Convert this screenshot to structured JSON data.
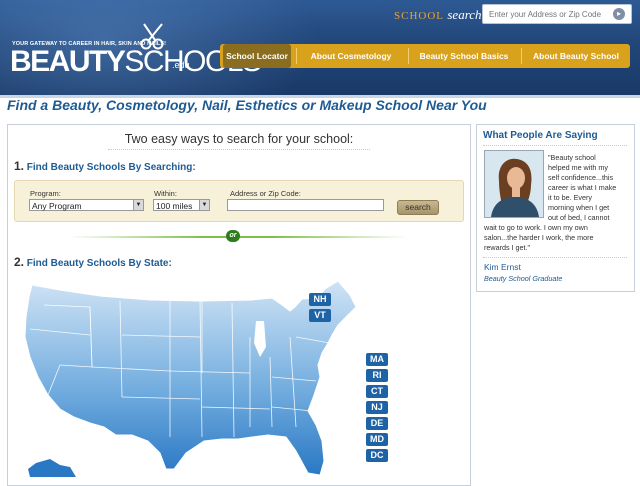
{
  "header": {
    "tagline": "YOUR GATEWAY TO CAREER IN HAIR, SKIN AND NAILS!",
    "logo_bold": "BEAUTY",
    "logo_light": "SCHOOLS",
    "logo_suffix": ".edu",
    "school_search_label_1": "SCHOOL",
    "school_search_label_2": "search",
    "search_placeholder": "Enter your Address or Zip Code",
    "nav": [
      {
        "label": "School Locator"
      },
      {
        "label": "About Cosmetology"
      },
      {
        "label": "Beauty School Basics"
      },
      {
        "label": "About Beauty School"
      }
    ]
  },
  "page": {
    "headline": "Find a Beauty, Cosmetology, Nail, Esthetics or Makeup School Near You"
  },
  "main": {
    "title": "Two easy ways to search for your school:",
    "step1_num": "1.",
    "step1_title": "Find Beauty Schools By Searching:",
    "program_label": "Program:",
    "program_value": "Any Program",
    "within_label": "Within:",
    "within_value": "100 miles",
    "zip_label": "Address or Zip Code:",
    "search_button": "search",
    "or_label": "or",
    "step2_num": "2.",
    "step2_title": "Find Beauty Schools By State:",
    "state_tags": [
      "NH",
      "VT",
      "MA",
      "RI",
      "CT",
      "NJ",
      "DE",
      "MD",
      "DC"
    ]
  },
  "sidebar": {
    "title": "What People Are Saying",
    "quote_lines_narrow": [
      "\"Beauty school",
      "helped me with my",
      "self confidence...this",
      "career is what I make",
      "it to be. Every",
      "morning when I get",
      "out of bed, I cannot"
    ],
    "quote_lines_wide": [
      "wait to go to work. I own my own",
      "salon...the harder I work, the more",
      "rewards I get.\""
    ],
    "author": "Kim Ernst",
    "author_role": "Beauty School Graduate"
  },
  "colors": {
    "header_blue": "#214679",
    "nav_gold": "#d9a21c",
    "nav_active": "#8a6d1e",
    "link_blue": "#1f5b93",
    "state_tag_blue": "#1d63a6",
    "or_green": "#2e7d1b"
  }
}
